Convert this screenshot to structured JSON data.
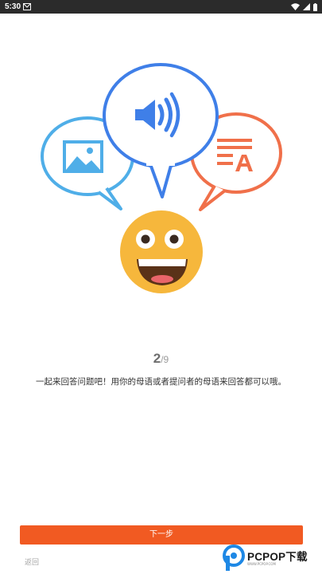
{
  "status_bar": {
    "time": "5:30",
    "icons": [
      "notification-icon",
      "wifi-icon",
      "signal-icon",
      "battery-icon"
    ]
  },
  "illustration": {
    "icons": [
      "image-icon",
      "speaker-volume-icon",
      "text-translate-icon",
      "grinning-face-icon"
    ],
    "colors": {
      "left_bubble": "#4faee8",
      "center_bubble": "#3f7fe8",
      "right_bubble": "#f0704a",
      "face": "#f6b73c"
    }
  },
  "pager": {
    "current": "2",
    "total": "/9"
  },
  "description": "一起来回答问题吧！用你的母语或者提问者的母语来回答都可以哦。",
  "buttons": {
    "next_label": "下一步",
    "back_label": "返回"
  },
  "watermark": {
    "text": "PCPOP下载",
    "subtext": "WWW.PCPOP.COM"
  },
  "colors": {
    "accent": "#f15a22"
  }
}
